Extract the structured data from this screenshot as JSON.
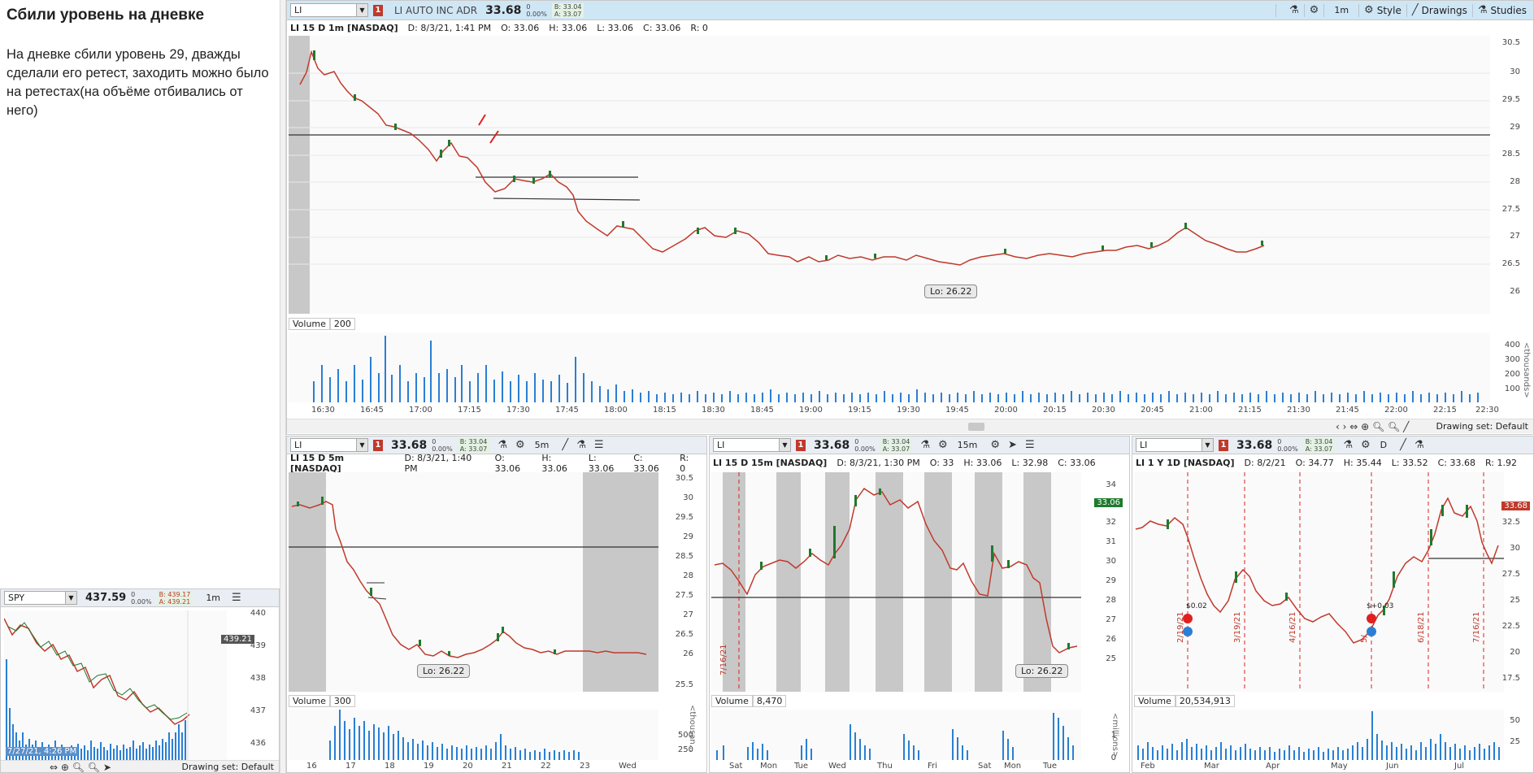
{
  "notes": {
    "title": "Сбили уровень на дневке",
    "body": "На дневке сбили уровень 29, дважды сделали его ретест, заходить можно было на ретестах(на объёме отбивались от него)"
  },
  "main_chart": {
    "symbol": "LI",
    "badge": "1",
    "description": "LI AUTO INC ADR",
    "price": "33.68",
    "change": "0",
    "change_pct": "0.00%",
    "bid": "B: 33.04",
    "ask": "A: 33.07",
    "toolbar": {
      "timeframe": "1m",
      "style": "Style",
      "drawings": "Drawings",
      "studies": "Studies"
    },
    "info": {
      "head": "LI 15 D 1m [NASDAQ]",
      "date": "D: 8/3/21, 1:41 PM",
      "open": "O: 33.06",
      "high": "H: 33.06",
      "low": "L: 33.06",
      "close": "C: 33.06",
      "range": "R: 0"
    },
    "y_ticks": [
      "30.5",
      "30",
      "29.5",
      "29",
      "28.5",
      "28",
      "27.5",
      "27",
      "26.5",
      "26"
    ],
    "x_ticks": [
      "16:30",
      "16:45",
      "17:00",
      "17:15",
      "17:30",
      "17:45",
      "18:00",
      "18:15",
      "18:30",
      "18:45",
      "19:00",
      "19:15",
      "19:30",
      "19:45",
      "20:00",
      "20:15",
      "20:30",
      "20:45",
      "21:00",
      "21:15",
      "21:30",
      "21:45",
      "22:00",
      "22:15",
      "22:30"
    ],
    "lo_label": "Lo: 26.22",
    "volume": {
      "label": "Volume",
      "value": "200",
      "ticks": [
        "400",
        "300",
        "200",
        "100"
      ],
      "unit": "<thousands>"
    },
    "drawing_set": "Drawing set: Default"
  },
  "chart_5m": {
    "symbol": "LI",
    "badge": "1",
    "price": "33.68",
    "change": "0",
    "change_pct": "0.00%",
    "bid": "B: 33.04",
    "ask": "A: 33.07",
    "timeframe": "5m",
    "info": {
      "head": "LI 15 D 5m [NASDAQ]",
      "date": "D: 8/3/21, 1:40 PM",
      "open": "O: 33.06",
      "high": "H: 33.06",
      "low": "L: 33.06",
      "close": "C: 33.06",
      "range": "R: 0"
    },
    "y_ticks": [
      "30.5",
      "30",
      "29.5",
      "29",
      "28.5",
      "28",
      "27.5",
      "27",
      "26.5",
      "26",
      "25.5"
    ],
    "x_ticks": [
      "16",
      "17",
      "18",
      "19",
      "20",
      "21",
      "22",
      "23",
      "Wed"
    ],
    "lo_label": "Lo: 26.22",
    "volume": {
      "label": "Volume",
      "value": "300",
      "ticks": [
        "500",
        "250"
      ],
      "unit": "<thousan..."
    }
  },
  "chart_15m": {
    "symbol": "LI",
    "badge": "1",
    "price": "33.68",
    "change": "0",
    "change_pct": "0.00%",
    "bid": "B: 33.04",
    "ask": "A: 33.07",
    "timeframe": "15m",
    "info": {
      "head": "LI 15 D 15m [NASDAQ]",
      "date": "D: 8/3/21, 1:30 PM",
      "open": "O: 33",
      "high": "H: 33.06",
      "low": "L: 32.98",
      "close": "C: 33.06"
    },
    "y_ticks": [
      "34",
      "33",
      "32",
      "31",
      "30",
      "29",
      "28",
      "27",
      "26",
      "25"
    ],
    "x_ticks": [
      "Sat",
      "Mon",
      "Tue",
      "Wed",
      "Thu",
      "Fri",
      "Sat",
      "Mon",
      "Tue"
    ],
    "current_tag": "33.06",
    "event_label": "7/16/21",
    "lo_label": "Lo: 26.22",
    "volume": {
      "label": "Volume",
      "value": "8,470",
      "ticks": [
        "1",
        "0"
      ],
      "unit": "<millions>"
    }
  },
  "chart_1d": {
    "symbol": "LI",
    "badge": "1",
    "price": "33.68",
    "change": "0",
    "change_pct": "0.00%",
    "bid": "B: 33.04",
    "ask": "A: 33.07",
    "timeframe": "D",
    "info": {
      "head": "LI 1 Y 1D [NASDAQ]",
      "date": "D: 8/2/21",
      "open": "O: 34.77",
      "high": "H: 35.44",
      "low": "L: 33.52",
      "close": "C: 33.68",
      "range": "R: 1.92"
    },
    "y_ticks": [
      "32.5",
      "30",
      "27.5",
      "25",
      "22.5",
      "20",
      "17.5"
    ],
    "x_ticks": [
      "Feb",
      "Mar",
      "Apr",
      "May",
      "Jun",
      "Jul"
    ],
    "current_tag": "33.68",
    "event_labels": [
      "2/19/21",
      "3/19/21",
      "4/16/21",
      "5/",
      "6/18/21",
      "7/16/21"
    ],
    "div_labels": [
      "$0.02",
      "$+0.03"
    ],
    "volume": {
      "label": "Volume",
      "value": "20,534,913",
      "ticks": [
        "50",
        "25"
      ]
    }
  },
  "spy_chart": {
    "symbol": "SPY",
    "price": "437.59",
    "change": "0",
    "change_pct": "0.00%",
    "bid": "B: 439.17",
    "ask": "A: 439.21",
    "timeframe": "1m",
    "y_ticks": [
      "440",
      "439",
      "438",
      "437",
      "436"
    ],
    "current_tag": "439.21",
    "date_label": "7/27/21, 4:26 PM",
    "drawing_set": "Drawing set: Default"
  },
  "colors": {
    "up": "#1e7a2e",
    "down": "#c0392b",
    "volume": "#2a7fd4",
    "toolbar": "#cfe6f5",
    "session_shade": "#c8c8c8"
  }
}
